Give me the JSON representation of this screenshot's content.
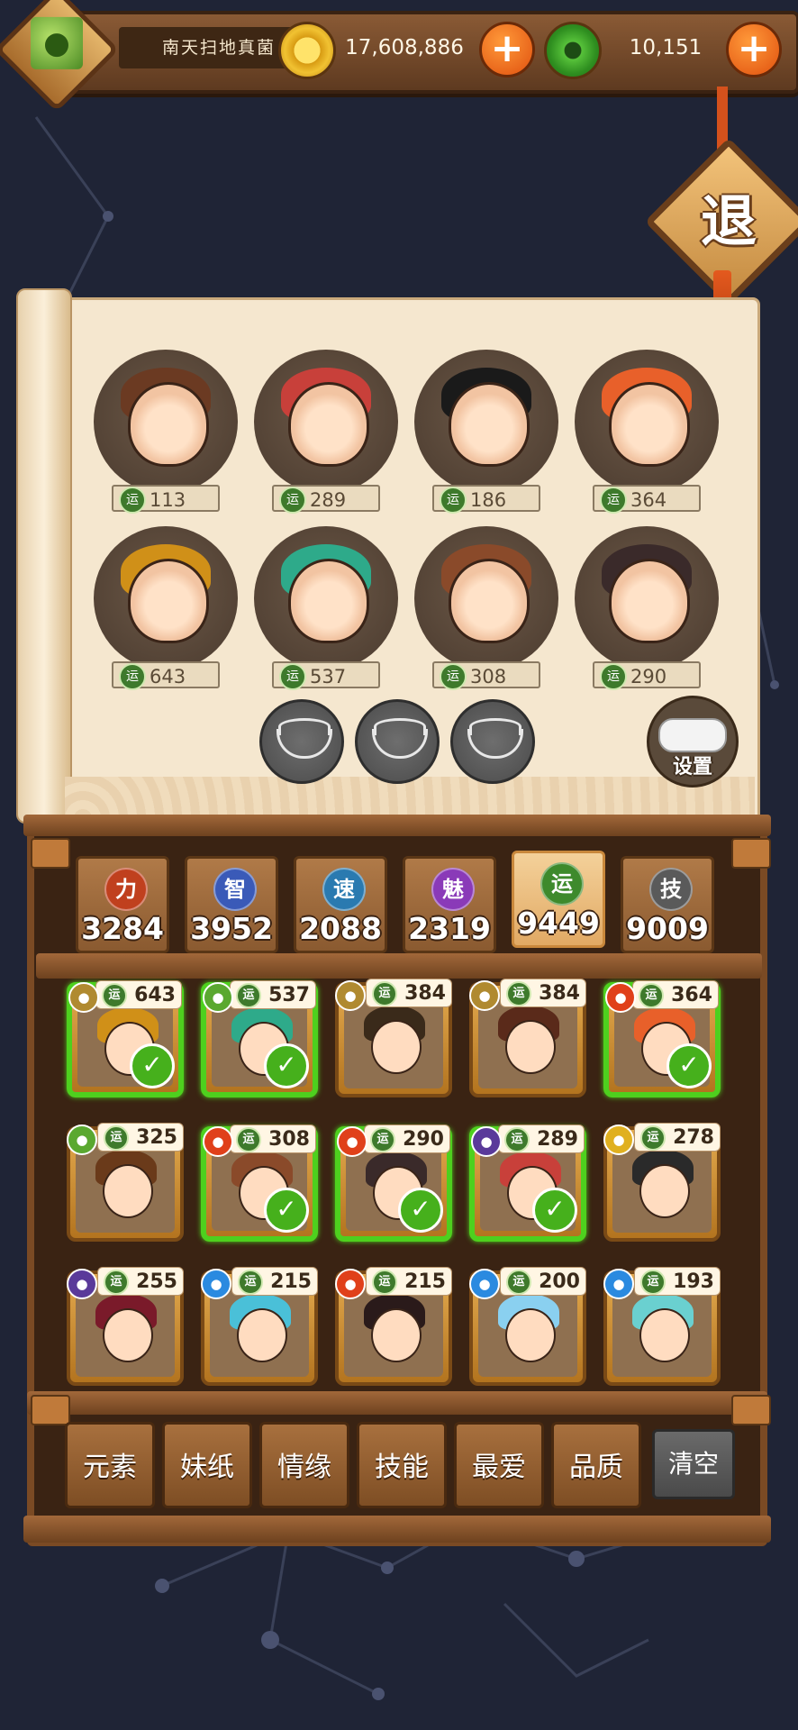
{
  "player": {
    "name": "南天扫地真菌"
  },
  "currency": {
    "gold": "17,608,886",
    "jade": "10,151",
    "plus_symbol": "+"
  },
  "exit_label": "退",
  "team": [
    {
      "stat": "113",
      "hair": "#6b3a22"
    },
    {
      "stat": "289",
      "hair": "#c8403a"
    },
    {
      "stat": "186",
      "hair": "#1a1a1a"
    },
    {
      "stat": "364",
      "hair": "#e8602a"
    },
    {
      "stat": "643",
      "hair": "#d09018"
    },
    {
      "stat": "537",
      "hair": "#2eaa8a"
    },
    {
      "stat": "308",
      "hair": "#8a4a2a"
    },
    {
      "stat": "290",
      "hair": "#3a2a2a"
    }
  ],
  "yun_glyph": "运",
  "settings_label": "设置",
  "attributes": [
    {
      "glyph": "力",
      "value": "3284",
      "color": "#c0401e"
    },
    {
      "glyph": "智",
      "value": "3952",
      "color": "#3a5ab8"
    },
    {
      "glyph": "速",
      "value": "2088",
      "color": "#2a7ab0"
    },
    {
      "glyph": "魅",
      "value": "2319",
      "color": "#8a3ab8"
    },
    {
      "glyph": "运",
      "value": "9449",
      "color": "#3e8a2c",
      "active": true
    },
    {
      "glyph": "技",
      "value": "9009",
      "color": "#5a5a5a"
    }
  ],
  "characters": [
    {
      "stat": "643",
      "element": "earth",
      "selected": true,
      "hair": "#d09018"
    },
    {
      "stat": "537",
      "element": "wood",
      "selected": true,
      "hair": "#2eaa8a"
    },
    {
      "stat": "384",
      "element": "earth",
      "selected": false,
      "hair": "#3a2a1a"
    },
    {
      "stat": "384",
      "element": "earth",
      "selected": false,
      "hair": "#5a2a1a"
    },
    {
      "stat": "364",
      "element": "fire",
      "selected": true,
      "hair": "#e8602a"
    },
    {
      "stat": "325",
      "element": "wood",
      "selected": false,
      "hair": "#6a3a1a"
    },
    {
      "stat": "308",
      "element": "fire",
      "selected": true,
      "hair": "#8a4a2a"
    },
    {
      "stat": "290",
      "element": "fire",
      "selected": true,
      "hair": "#3a2a2a"
    },
    {
      "stat": "289",
      "element": "dark",
      "selected": true,
      "hair": "#c8403a"
    },
    {
      "stat": "278",
      "element": "light",
      "selected": false,
      "hair": "#2a2a2a"
    },
    {
      "stat": "255",
      "element": "dark",
      "selected": false,
      "hair": "#7a1a2a"
    },
    {
      "stat": "215",
      "element": "water",
      "selected": false,
      "hair": "#4ac0d8"
    },
    {
      "stat": "215",
      "element": "fire",
      "selected": false,
      "hair": "#2a1a1a"
    },
    {
      "stat": "200",
      "element": "water",
      "selected": false,
      "hair": "#8ad0f0"
    },
    {
      "stat": "193",
      "element": "water",
      "selected": false,
      "hair": "#6ad0d0"
    }
  ],
  "element_colors": {
    "earth": "#b08a30",
    "wood": "#5aa830",
    "fire": "#e0401a",
    "dark": "#5a3a9a",
    "light": "#e0b020",
    "water": "#2a8ae0"
  },
  "check_glyph": "✓",
  "filters": [
    "元素",
    "妹纸",
    "情缘",
    "技能",
    "最爱",
    "品质"
  ],
  "clear_label": "清空"
}
